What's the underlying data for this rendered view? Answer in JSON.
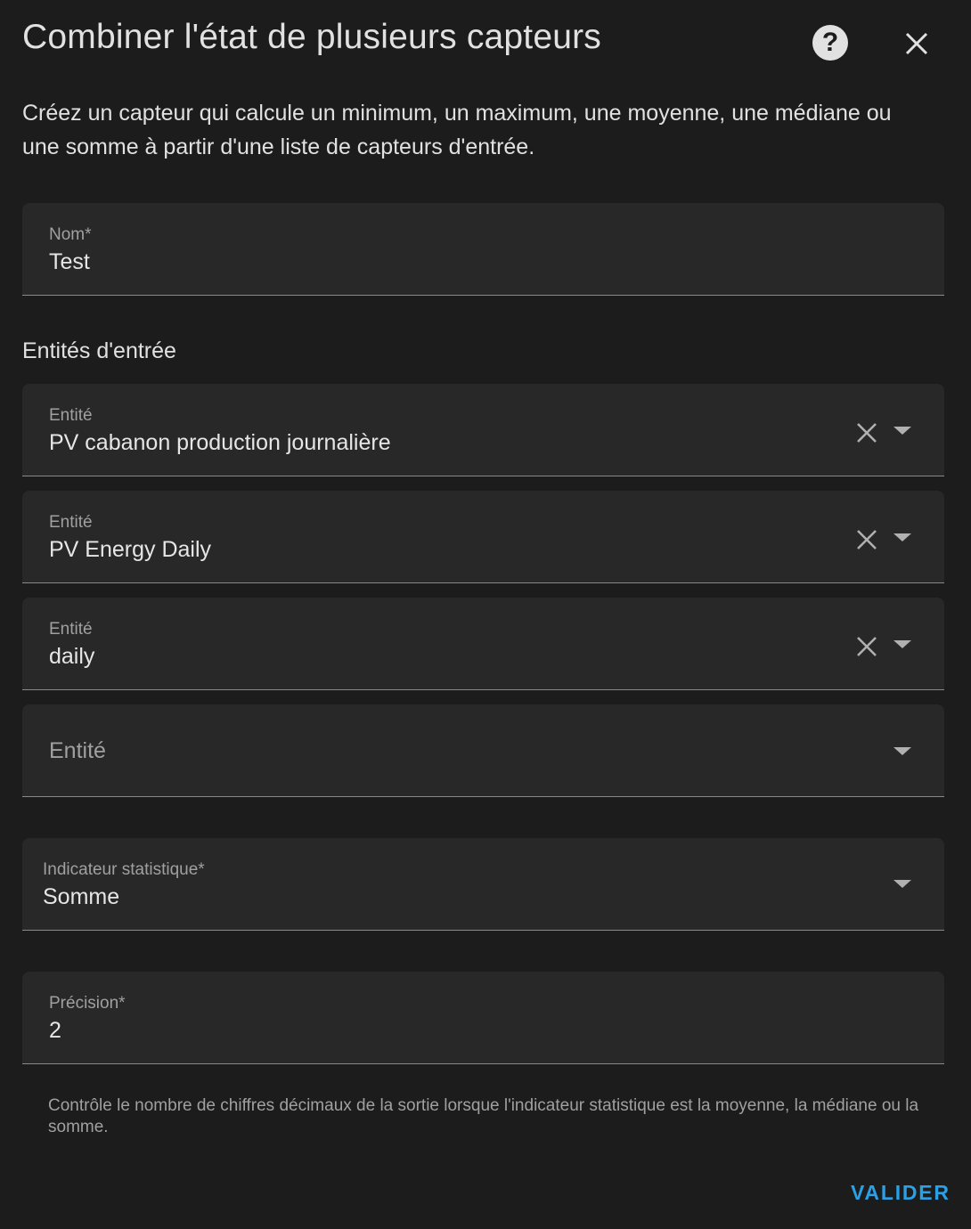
{
  "dialog": {
    "title": "Combiner l'état de plusieurs capteurs",
    "help_icon": "help-circle-icon",
    "close_icon": "close-icon",
    "description": "Créez un capteur qui calcule un minimum, un maximum, une moyenne, une médiane ou une somme à partir d'une liste de capteurs d'entrée."
  },
  "name_field": {
    "label": "Nom*",
    "value": "Test"
  },
  "entities_section": {
    "title": "Entités d'entrée",
    "entities": [
      {
        "label": "Entité",
        "value": "PV cabanon production journalière"
      },
      {
        "label": "Entité",
        "value": "PV Energy Daily"
      },
      {
        "label": "Entité",
        "value": "daily"
      }
    ],
    "empty_entity_label": "Entité"
  },
  "statistic_field": {
    "label": "Indicateur statistique*",
    "value": "Somme"
  },
  "precision_field": {
    "label": "Précision*",
    "value": "2",
    "helper": "Contrôle le nombre de chiffres décimaux de la sortie lorsque l'indicateur statistique est la moyenne, la médiane ou la somme."
  },
  "submit_label": "VALIDER",
  "colors": {
    "background": "#1c1c1c",
    "field_background": "#282828",
    "accent": "#2aa0e6"
  }
}
